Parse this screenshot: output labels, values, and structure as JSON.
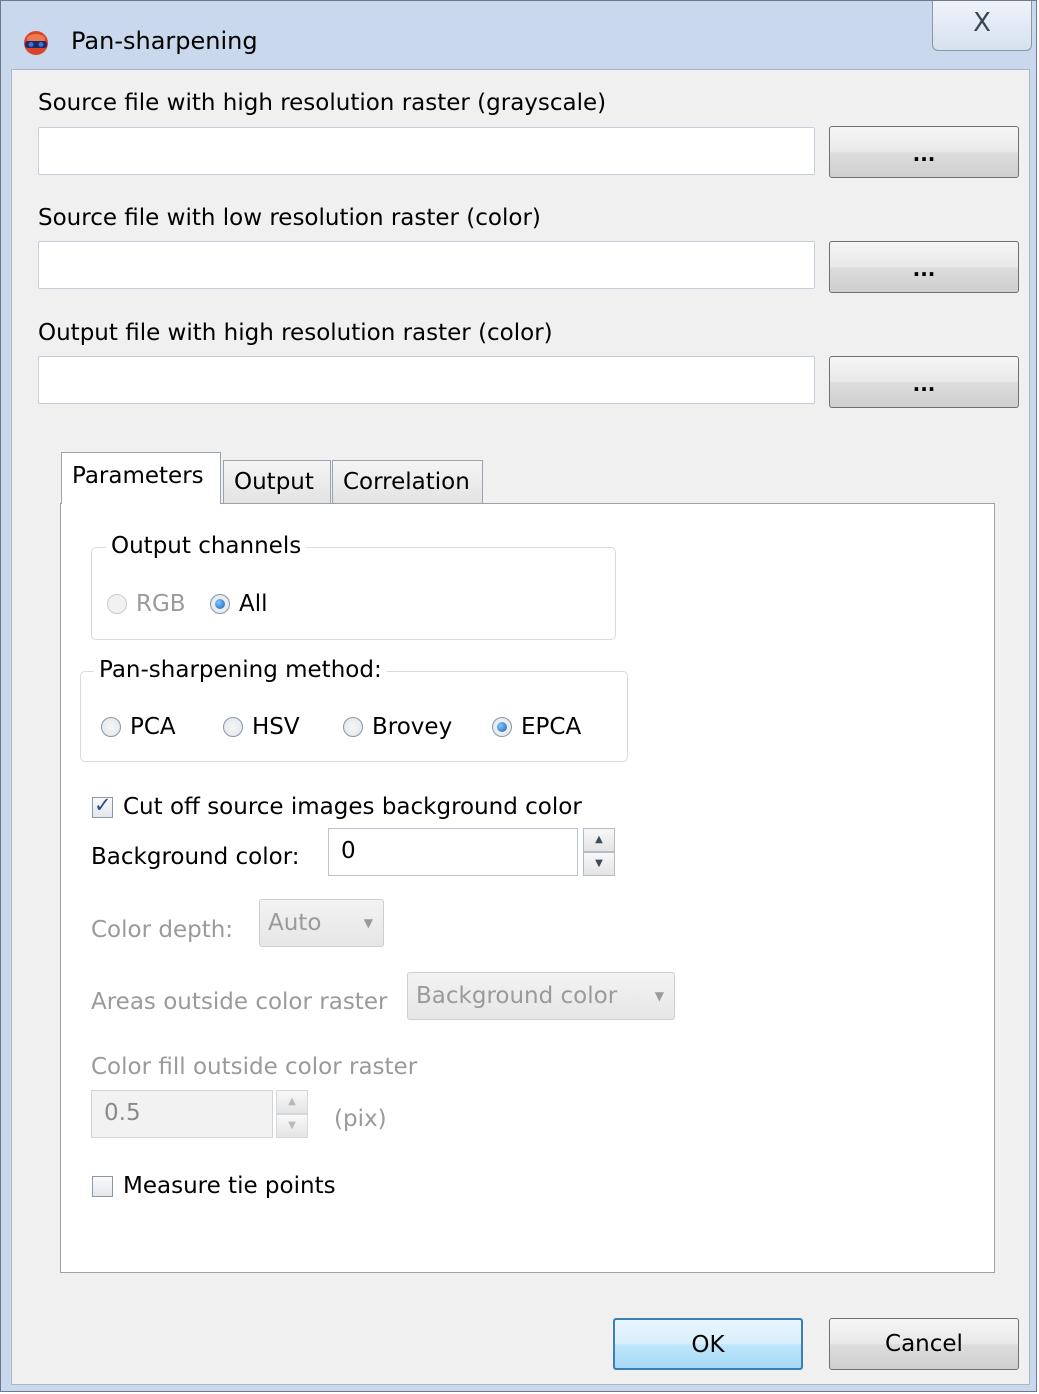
{
  "window": {
    "title": "Pan-sharpening",
    "close_glyph": "X"
  },
  "source_high": {
    "label": "Source file with high resolution raster (grayscale)",
    "value": "",
    "browse_label": "..."
  },
  "source_low": {
    "label": "Source file with low resolution raster (color)",
    "value": "",
    "browse_label": "..."
  },
  "output_high": {
    "label": "Output file with high resolution raster (color)",
    "value": "",
    "browse_label": "..."
  },
  "tabs": [
    {
      "label": "Parameters",
      "active": true
    },
    {
      "label": "Output",
      "active": false
    },
    {
      "label": "Correlation",
      "active": false
    }
  ],
  "output_channels": {
    "title": "Output channels",
    "options": [
      {
        "label": "RGB",
        "selected": false,
        "enabled": false
      },
      {
        "label": "All",
        "selected": true,
        "enabled": true
      }
    ]
  },
  "method": {
    "title": "Pan-sharpening method:",
    "options": [
      {
        "label": "PCA",
        "selected": false
      },
      {
        "label": "HSV",
        "selected": false
      },
      {
        "label": "Brovey",
        "selected": false
      },
      {
        "label": "EPCA",
        "selected": true
      }
    ]
  },
  "cut_off": {
    "label": "Cut off source images background color",
    "checked": true
  },
  "background_color": {
    "label": "Background color:",
    "value": "0"
  },
  "color_depth": {
    "label": "Color depth:",
    "value": "Auto"
  },
  "areas_outside": {
    "label": "Areas outside color raster",
    "value": "Background color"
  },
  "color_fill": {
    "label": "Color fill outside color raster",
    "value": "0.5",
    "unit": "(pix)"
  },
  "measure_tie_points": {
    "label": "Measure tie points",
    "checked": false
  },
  "buttons": {
    "ok": "OK",
    "cancel": "Cancel"
  }
}
